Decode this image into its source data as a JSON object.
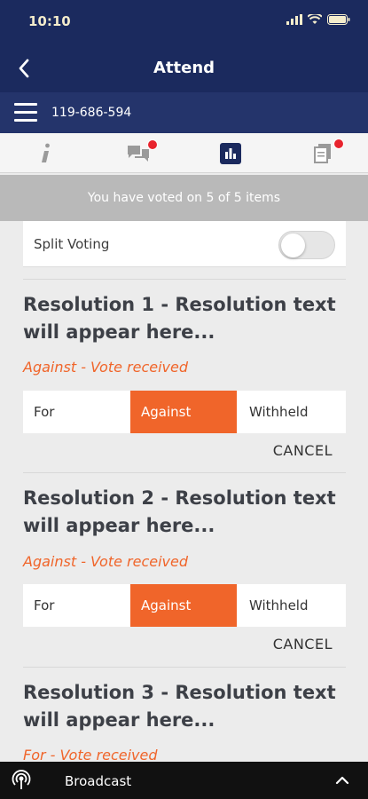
{
  "status_bar": {
    "time": "10:10"
  },
  "nav": {
    "title": "Attend"
  },
  "meeting": {
    "id": "119-686-594"
  },
  "tabs": [
    {
      "icon": "info-icon",
      "badge": false
    },
    {
      "icon": "chat-icon",
      "badge": true
    },
    {
      "icon": "voting-chart-icon",
      "badge": false,
      "active": true
    },
    {
      "icon": "documents-icon",
      "badge": true
    }
  ],
  "banner": {
    "text": "You have voted on 5 of 5 items"
  },
  "split_voting": {
    "label": "Split Voting",
    "enabled": false
  },
  "resolutions": [
    {
      "title_line1": "Resolution 1 - Resolution text",
      "title_line2": "will appear here...",
      "status": "Against - Vote received",
      "options": [
        "For",
        "Against",
        "Withheld"
      ],
      "selected": "Against",
      "cancel_label": "CANCEL"
    },
    {
      "title_line1": "Resolution 2 - Resolution text",
      "title_line2": "will appear here...",
      "status": "Against - Vote received",
      "options": [
        "For",
        "Against",
        "Withheld"
      ],
      "selected": "Against",
      "cancel_label": "CANCEL"
    },
    {
      "title_line1": "Resolution 3 - Resolution text",
      "title_line2": "will appear here...",
      "status": "For - Vote received"
    }
  ],
  "broadcast": {
    "label": "Broadcast"
  },
  "colors": {
    "navy": "#1b2a5e",
    "accent_orange": "#f0652a",
    "badge_red": "#e8232d"
  }
}
